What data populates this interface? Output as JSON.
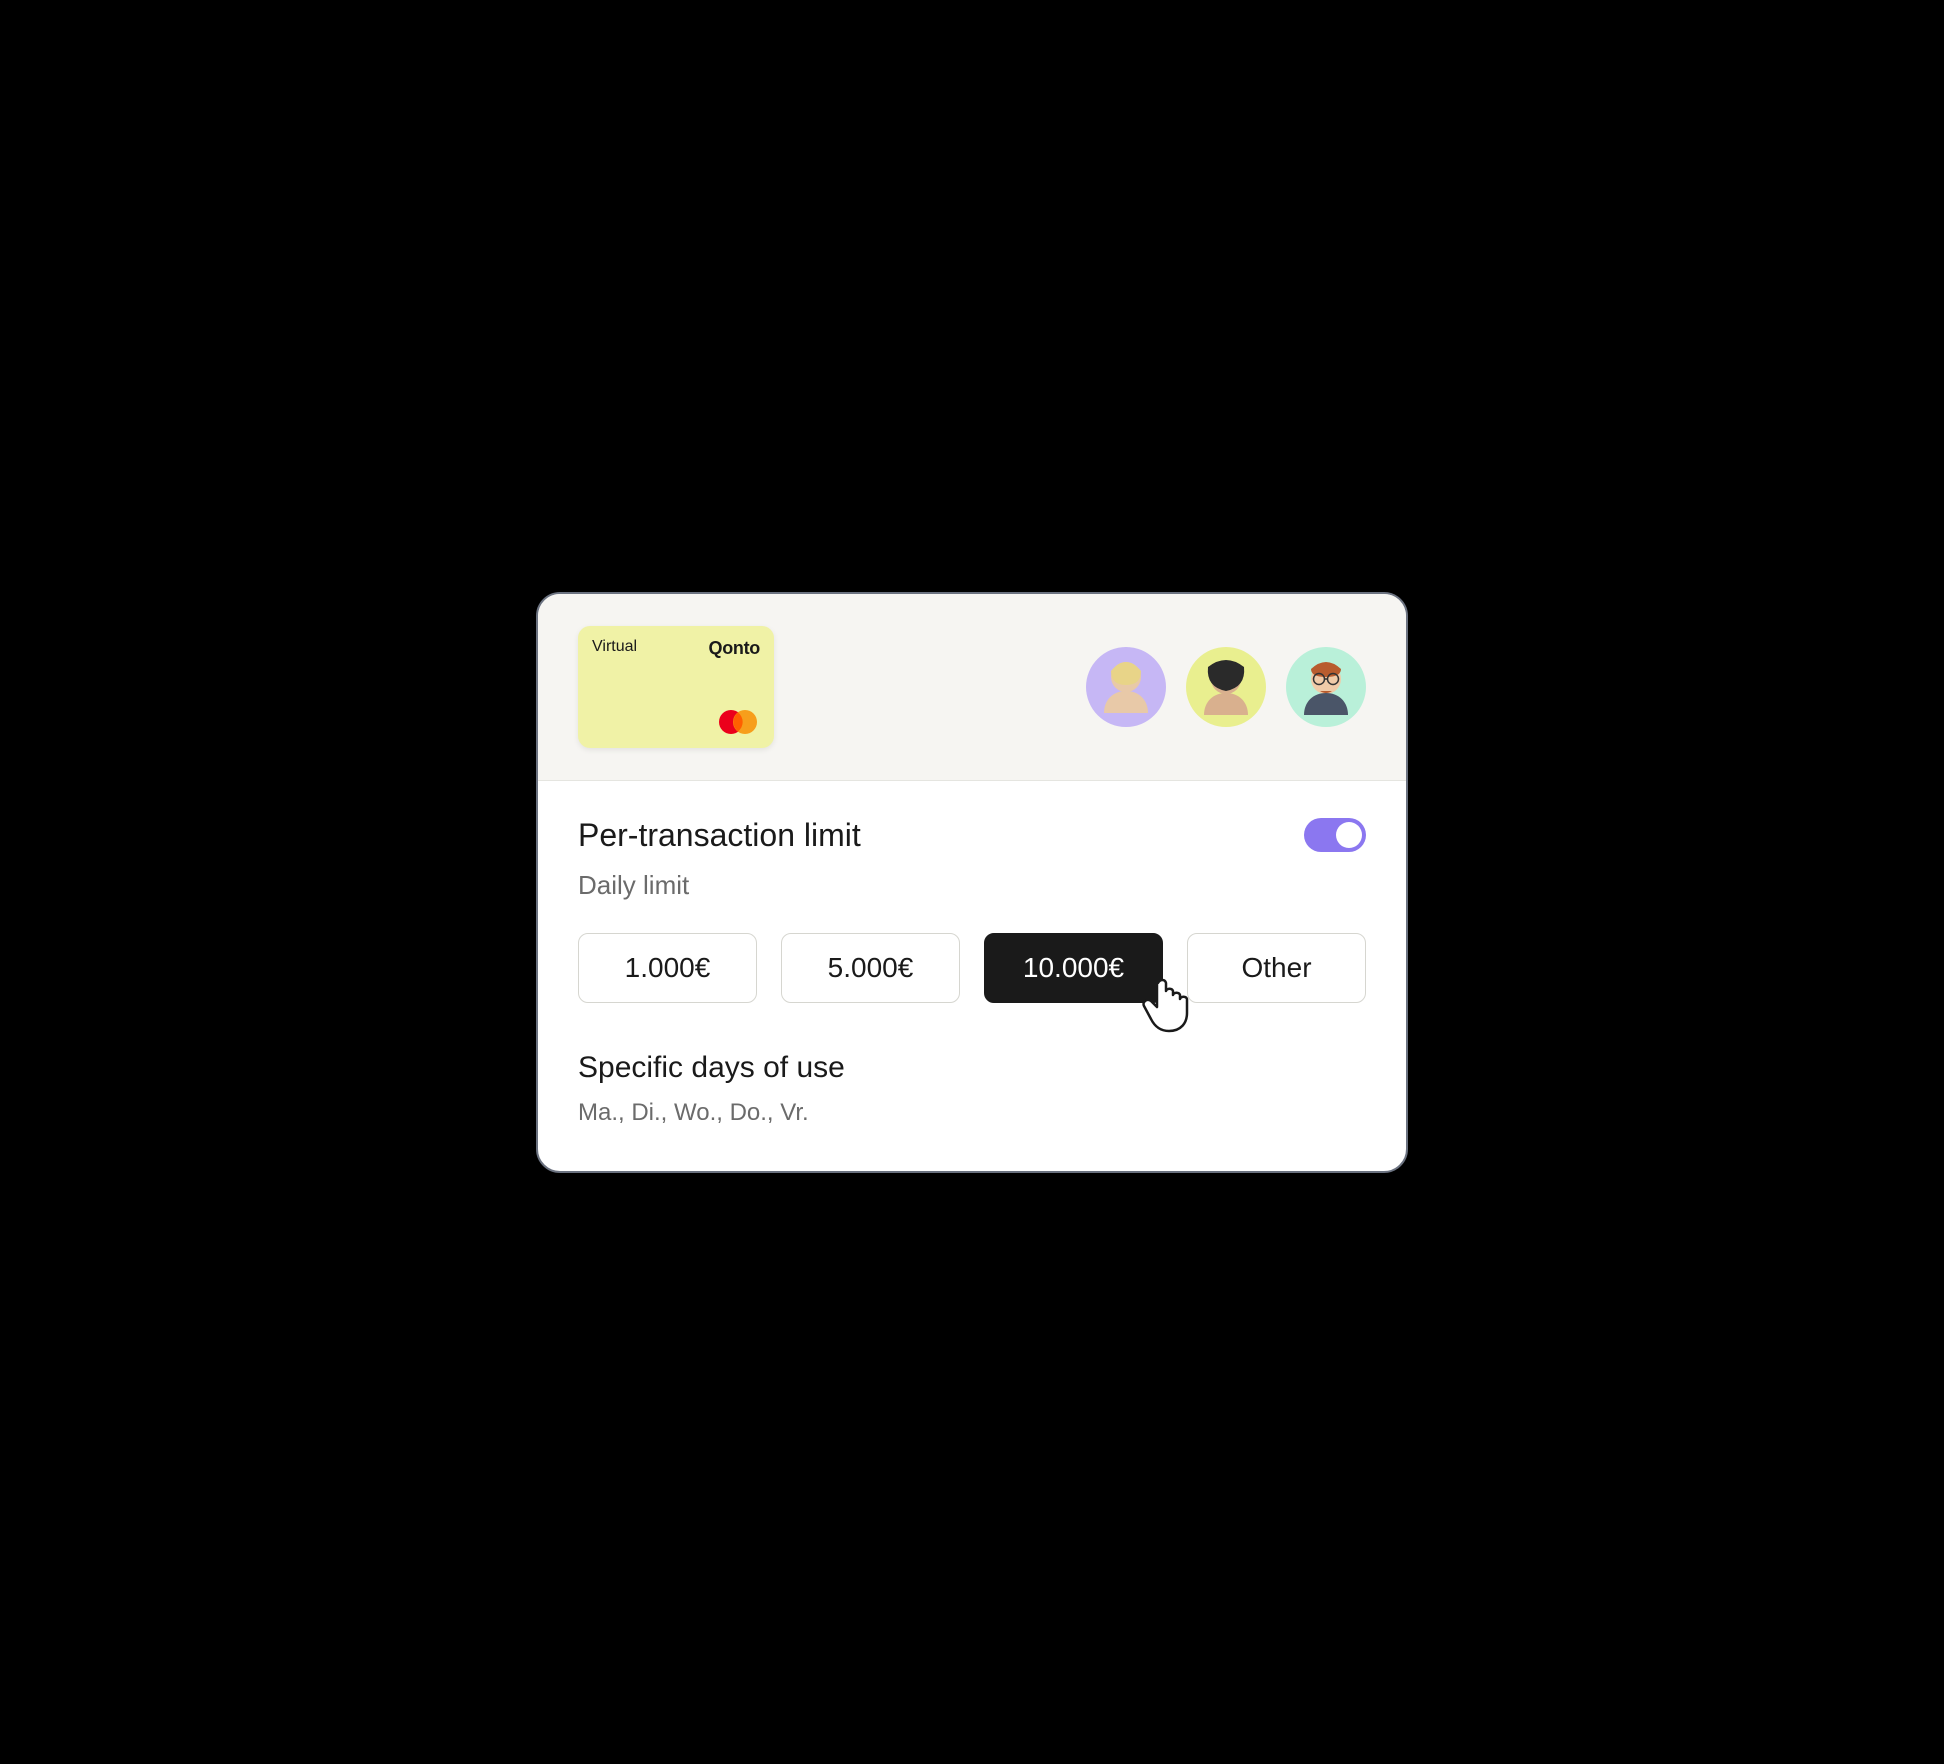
{
  "card": {
    "type": "Virtual",
    "brand": "Qonto"
  },
  "avatars": [
    {
      "bg": "#c6b7f5"
    },
    {
      "bg": "#e9ef8f"
    },
    {
      "bg": "#b9f0d9"
    }
  ],
  "limits": {
    "title": "Per-transaction limit",
    "toggle_on": true,
    "daily_label": "Daily limit",
    "options": [
      {
        "label": "1.000€",
        "selected": false
      },
      {
        "label": "5.000€",
        "selected": false
      },
      {
        "label": "10.000€",
        "selected": true
      },
      {
        "label": "Other",
        "selected": false
      }
    ]
  },
  "days": {
    "title": "Specific days of use",
    "value": "Ma., Di., Wo., Do., Vr."
  }
}
